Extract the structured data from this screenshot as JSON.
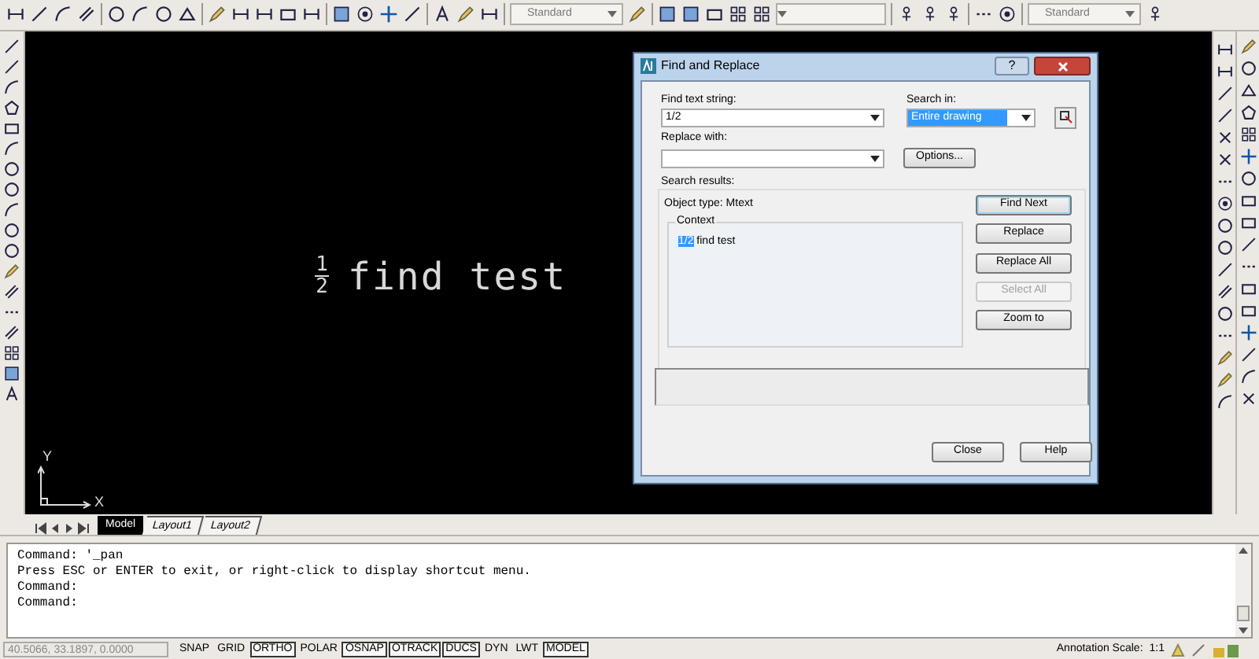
{
  "toolbar": {
    "style_dropdowns": [
      {
        "value": "Standard"
      },
      {
        "value": "Standard"
      }
    ]
  },
  "drawing": {
    "numerator": "1",
    "denominator": "2",
    "text": "find test"
  },
  "ucs": {
    "y_label": "Y",
    "x_label": "X"
  },
  "layout_tabs": [
    {
      "label": "Model",
      "selected": true
    },
    {
      "label": "Layout1",
      "selected": false
    },
    {
      "label": "Layout2",
      "selected": false
    }
  ],
  "dialog": {
    "title": "Find and Replace",
    "help": "?",
    "find_label": "Find text string:",
    "find_value": "1/2",
    "replace_label": "Replace with:",
    "search_in_label": "Search in:",
    "search_in_value": "Entire drawing",
    "options_button": "Options...",
    "results_label": "Search results:",
    "object_type": "Object type: Mtext",
    "context_label": "Context",
    "context_match": "1/2",
    "context_rest": " find test",
    "side_buttons": [
      {
        "label": "Find Next",
        "disabled": false,
        "default": true
      },
      {
        "label": "Replace",
        "disabled": false,
        "default": false
      },
      {
        "label": "Replace All",
        "disabled": false,
        "default": false
      },
      {
        "label": "Select All",
        "disabled": true,
        "default": false
      },
      {
        "label": "Zoom to",
        "disabled": false,
        "default": false
      }
    ],
    "bottom_buttons": [
      "Close",
      "Help"
    ]
  },
  "command_lines": [
    "Command: '_pan",
    "Press ESC or ENTER to exit, or right-click to display shortcut menu.",
    "Command:",
    "Command:"
  ],
  "status_bar": {
    "coordinates": "40.5066, 33.1897, 0.0000",
    "toggles": [
      {
        "label": "SNAP",
        "on": false
      },
      {
        "label": "GRID",
        "on": false
      },
      {
        "label": "ORTHO",
        "on": true
      },
      {
        "label": "POLAR",
        "on": false
      },
      {
        "label": "OSNAP",
        "on": true
      },
      {
        "label": "OTRACK",
        "on": true
      },
      {
        "label": "DUCS",
        "on": true
      },
      {
        "label": "DYN",
        "on": false
      },
      {
        "label": "LWT",
        "on": false
      },
      {
        "label": "MODEL",
        "on": true
      }
    ],
    "annotation_scale_label": "Annotation Scale:",
    "annotation_scale_value": "1:1"
  }
}
